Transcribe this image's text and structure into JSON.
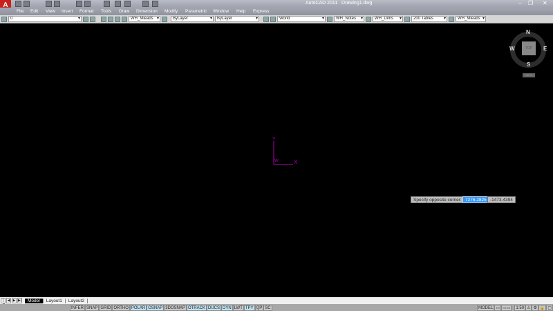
{
  "app": {
    "logo": "A",
    "title": "AutoCAD 2011",
    "document": "Drawing1.dwg"
  },
  "window_controls": {
    "minimize": "–",
    "maximize": "❐",
    "close": "✕"
  },
  "menus": [
    "File",
    "Edit",
    "View",
    "Insert",
    "Format",
    "Tools",
    "Draw",
    "Dimension",
    "Modify",
    "Parametric",
    "Window",
    "Help",
    "Express"
  ],
  "toolbar": {
    "layer": "0",
    "mleader_style": "WH_Mleads",
    "color": "ByLayer",
    "linetype": "ByLayer",
    "ucs": "World",
    "text_style": "WH_Notes",
    "dim_style": "WH_Dims",
    "table_style": "200 Tables",
    "mleader_style2": "WH_Mleads"
  },
  "ucs_icon": {
    "x": "X",
    "y": "Y",
    "w": "W"
  },
  "viewcube": {
    "n": "N",
    "s": "S",
    "e": "E",
    "w": "W",
    "face": "TOP",
    "wcs": "WCS"
  },
  "prompt": {
    "label": "Specify opposite corner:",
    "x": "7276.2825",
    "y": "-1473.4394"
  },
  "tabs": [
    "Model",
    "Layout1",
    "Layout2"
  ],
  "status": {
    "toggles": [
      {
        "label": "INFER",
        "on": false
      },
      {
        "label": "SNAP",
        "on": false
      },
      {
        "label": "GRID",
        "on": false
      },
      {
        "label": "ORTHO",
        "on": false
      },
      {
        "label": "POLAR",
        "on": true
      },
      {
        "label": "OSNAP",
        "on": true
      },
      {
        "label": "3DOSNAP",
        "on": false
      },
      {
        "label": "OTRACK",
        "on": true
      },
      {
        "label": "DUCS",
        "on": true
      },
      {
        "label": "DYN",
        "on": true
      },
      {
        "label": "LWT",
        "on": false
      },
      {
        "label": "TPY",
        "on": true
      },
      {
        "label": "QP",
        "on": false
      },
      {
        "label": "SC",
        "on": false
      }
    ],
    "space": "MODEL",
    "scale": "1:50"
  },
  "colors": {
    "ucs": "#b000b0",
    "canvas": "#000000",
    "highlight": "#3399ff"
  }
}
